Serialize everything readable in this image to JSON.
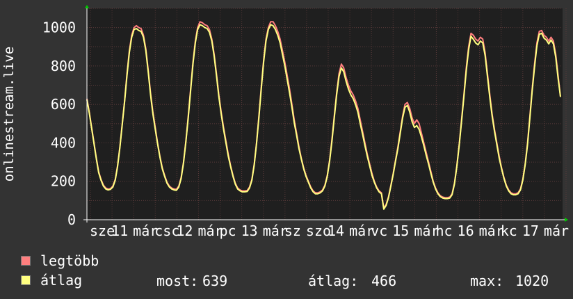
{
  "chart_data": {
    "type": "line",
    "ylabel": "onlinestream.live",
    "ylim": [
      0,
      1100
    ],
    "yticks": [
      0,
      200,
      400,
      600,
      800,
      1000
    ],
    "grid": true,
    "x_tick_labels": [
      "sze",
      "11",
      "már",
      "csc",
      "12",
      "már",
      "pc",
      "13",
      "már",
      "sz",
      "szo",
      "14",
      "már",
      "vc",
      "15",
      "már",
      "hc",
      "16",
      "már",
      "kc",
      "17",
      "már"
    ],
    "series": [
      {
        "name": "legtöbb",
        "color": "#ff7f7f",
        "values": [
          630,
          560,
          480,
          400,
          320,
          250,
          210,
          180,
          165,
          160,
          162,
          175,
          210,
          280,
          380,
          500,
          620,
          760,
          880,
          960,
          1000,
          1010,
          1000,
          995,
          960,
          890,
          780,
          660,
          560,
          480,
          400,
          330,
          270,
          230,
          195,
          175,
          165,
          160,
          158,
          175,
          220,
          300,
          410,
          540,
          680,
          820,
          930,
          1000,
          1030,
          1025,
          1015,
          1010,
          990,
          940,
          860,
          760,
          650,
          560,
          480,
          410,
          340,
          280,
          230,
          190,
          165,
          155,
          150,
          150,
          152,
          170,
          210,
          290,
          400,
          540,
          690,
          830,
          940,
          1000,
          1030,
          1030,
          1010,
          980,
          940,
          880,
          820,
          750,
          680,
          600,
          520,
          450,
          380,
          320,
          270,
          230,
          200,
          170,
          150,
          140,
          140,
          145,
          155,
          180,
          230,
          310,
          420,
          540,
          660,
          760,
          810,
          790,
          740,
          700,
          670,
          650,
          620,
          580,
          520,
          460,
          400,
          340,
          290,
          240,
          200,
          170,
          150,
          140,
          60,
          80,
          120,
          180,
          240,
          310,
          380,
          460,
          540,
          600,
          610,
          580,
          530,
          500,
          520,
          500,
          450,
          400,
          350,
          300,
          250,
          200,
          165,
          140,
          125,
          118,
          115,
          115,
          118,
          135,
          190,
          280,
          390,
          520,
          650,
          790,
          900,
          970,
          960,
          940,
          930,
          950,
          940,
          870,
          760,
          650,
          550,
          470,
          400,
          330,
          270,
          220,
          180,
          155,
          140,
          135,
          135,
          140,
          160,
          210,
          290,
          400,
          540,
          680,
          810,
          920,
          980,
          985,
          960,
          950,
          930,
          950,
          930,
          860,
          750,
          640
        ],
        "draw_order": 1
      },
      {
        "name": "átlag",
        "color": "#ffff80",
        "values": [
          625,
          555,
          475,
          395,
          315,
          245,
          205,
          175,
          160,
          155,
          158,
          170,
          205,
          275,
          375,
          495,
          615,
          750,
          870,
          950,
          990,
          995,
          985,
          980,
          950,
          880,
          770,
          650,
          550,
          470,
          395,
          325,
          265,
          225,
          190,
          170,
          160,
          155,
          153,
          170,
          215,
          295,
          405,
          530,
          670,
          810,
          920,
          990,
          1015,
          1010,
          1000,
          995,
          975,
          930,
          850,
          750,
          640,
          550,
          470,
          400,
          330,
          275,
          225,
          185,
          160,
          150,
          145,
          145,
          147,
          165,
          205,
          285,
          395,
          530,
          680,
          820,
          930,
          990,
          1015,
          1010,
          990,
          960,
          920,
          860,
          800,
          730,
          660,
          585,
          505,
          440,
          370,
          315,
          265,
          225,
          195,
          165,
          145,
          135,
          135,
          140,
          150,
          175,
          225,
          305,
          410,
          530,
          650,
          745,
          790,
          770,
          720,
          680,
          650,
          630,
          600,
          560,
          500,
          445,
          385,
          330,
          280,
          230,
          195,
          165,
          145,
          135,
          55,
          75,
          115,
          175,
          235,
          305,
          370,
          450,
          530,
          585,
          595,
          560,
          510,
          480,
          490,
          470,
          430,
          385,
          335,
          290,
          240,
          195,
          160,
          135,
          120,
          113,
          110,
          110,
          113,
          130,
          185,
          275,
          385,
          510,
          640,
          775,
          885,
          955,
          940,
          920,
          910,
          930,
          920,
          855,
          745,
          635,
          540,
          460,
          390,
          320,
          265,
          215,
          175,
          150,
          135,
          130,
          130,
          135,
          155,
          205,
          285,
          390,
          530,
          670,
          795,
          905,
          965,
          970,
          945,
          935,
          915,
          935,
          915,
          845,
          735,
          639
        ],
        "draw_order": 2
      }
    ]
  },
  "legend": [
    {
      "label": "legtöbb",
      "color": "#ff7f7f"
    },
    {
      "label": "átlag",
      "color": "#ffff80"
    }
  ],
  "stats": {
    "now_label": "most:",
    "now_value": "639",
    "avg_label": "átlag:",
    "avg_value": "466",
    "max_label": "max:",
    "max_value": "1020"
  }
}
